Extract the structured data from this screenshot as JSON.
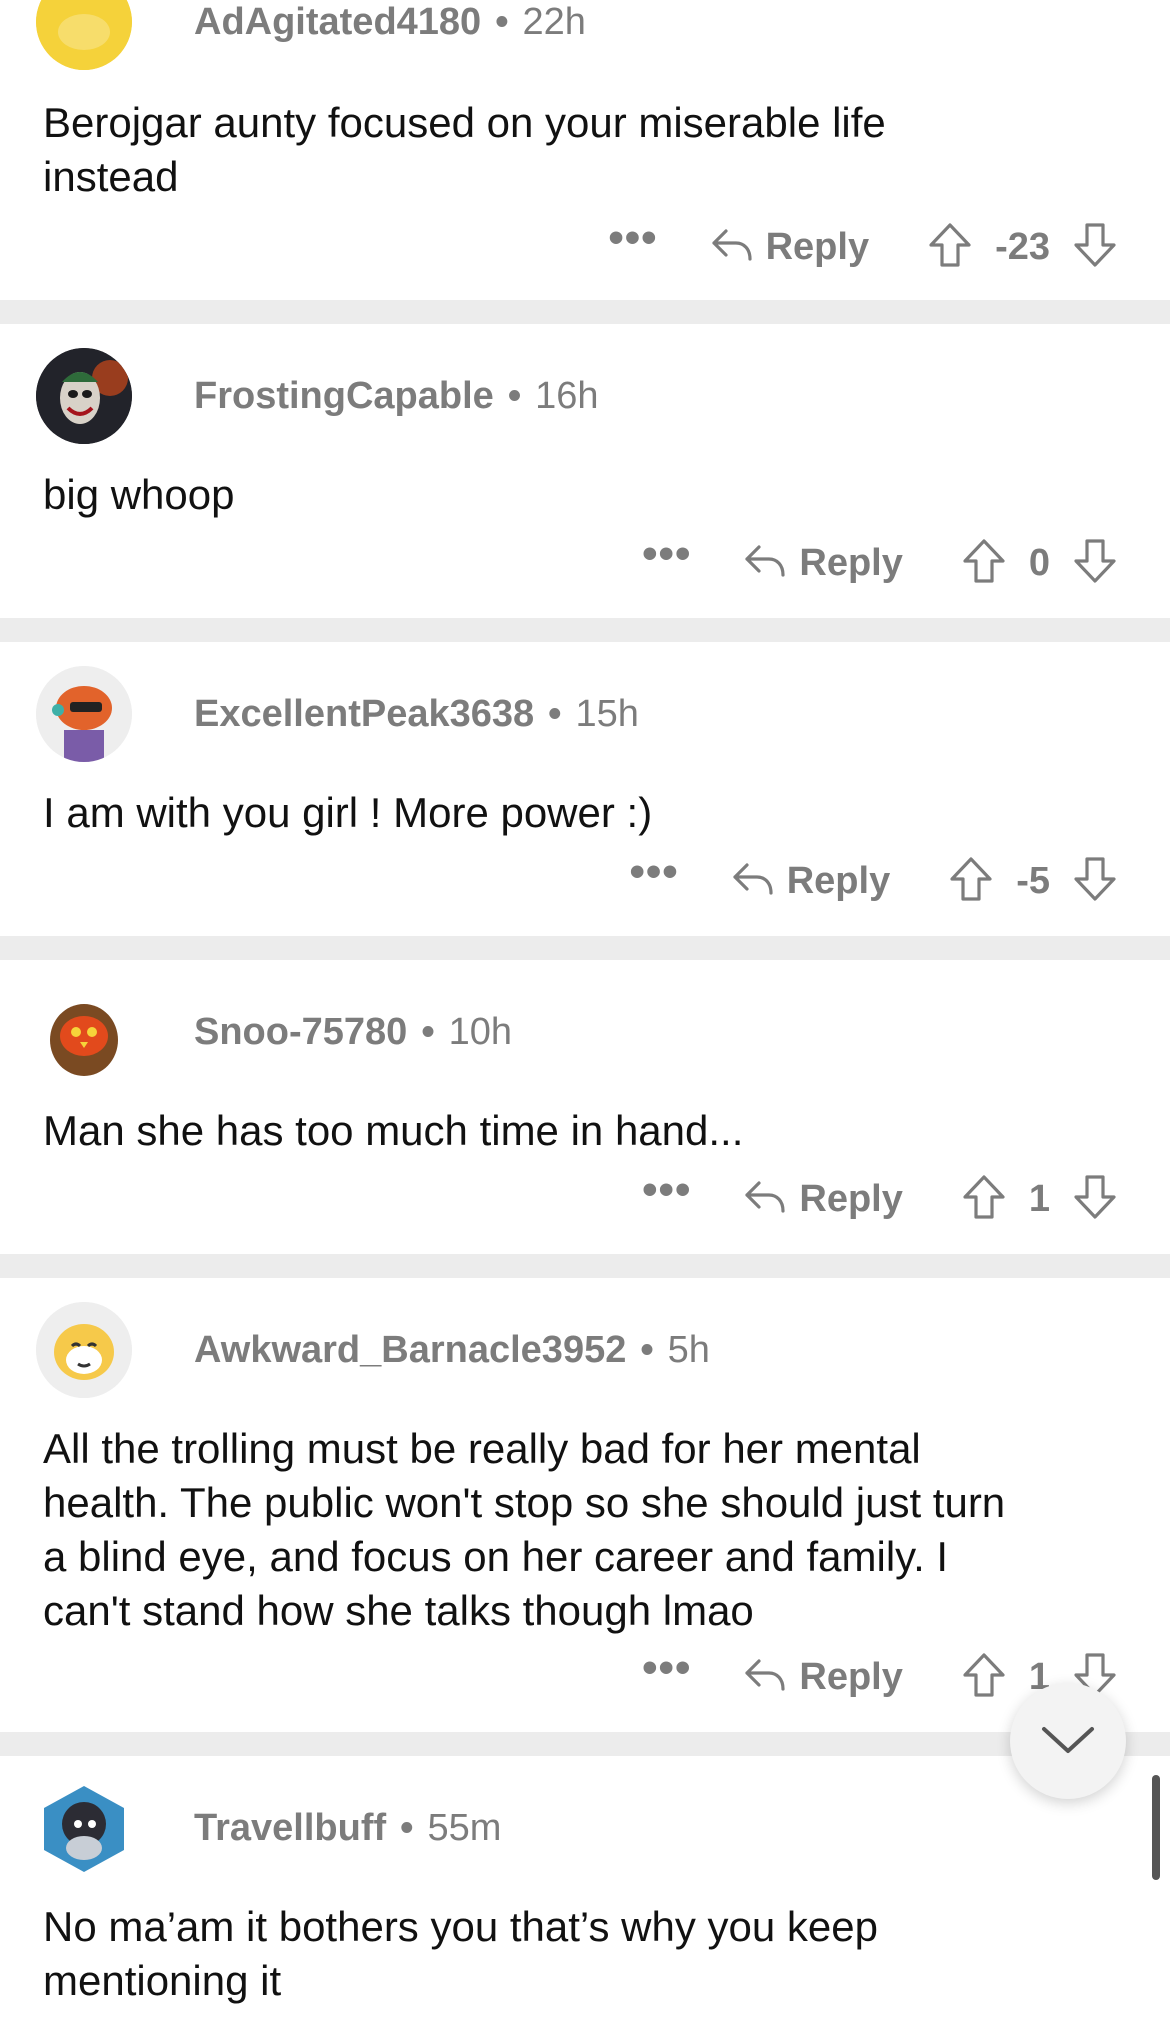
{
  "comments": [
    {
      "username": "AdAgitated4180",
      "age": "22h",
      "body": "Berojgar aunty focused on your miserable life\ninstead",
      "reply_label": "Reply",
      "score": "-23",
      "avatar_icon": "snoo-yellow-avatar-icon"
    },
    {
      "username": "FrostingCapable",
      "age": "16h",
      "body": "big whoop",
      "reply_label": "Reply",
      "score": "0",
      "avatar_icon": "joker-avatar-icon"
    },
    {
      "username": "ExcellentPeak3638",
      "age": "15h",
      "body": "I am with you girl ! More power :)",
      "reply_label": "Reply",
      "score": "-5",
      "avatar_icon": "snoo-gamer-avatar-icon"
    },
    {
      "username": "Snoo-75780",
      "age": "10h",
      "body": "Man she has too much time in hand...",
      "reply_label": "Reply",
      "score": "1",
      "avatar_icon": "snoo-owl-avatar-icon"
    },
    {
      "username": "Awkward_Barnacle3952",
      "age": "5h",
      "body": "All the trolling must be really bad for her mental\nhealth. The public won't stop so she should just turn\na blind eye, and focus on her career and family. I\ncan't stand how she talks though lmao",
      "reply_label": "Reply",
      "score": "1",
      "avatar_icon": "snoo-shiba-avatar-icon"
    },
    {
      "username": "Travellbuff",
      "age": "55m",
      "body": "No ma’am it bothers you that’s why you keep\nmentioning it",
      "avatar_icon": "snoo-robot-avatar-icon"
    }
  ],
  "more_label": "•••",
  "separator_dot": "•",
  "icons": {
    "reply": "reply-arrow-icon",
    "upvote": "upvote-arrow-icon",
    "downvote": "downvote-arrow-icon",
    "scroll_down": "chevron-down-icon"
  },
  "colors": {
    "text": "#111111",
    "muted": "#7c7c7c",
    "separator": "#ececec",
    "snoo_yellow": "#f5d23a"
  }
}
